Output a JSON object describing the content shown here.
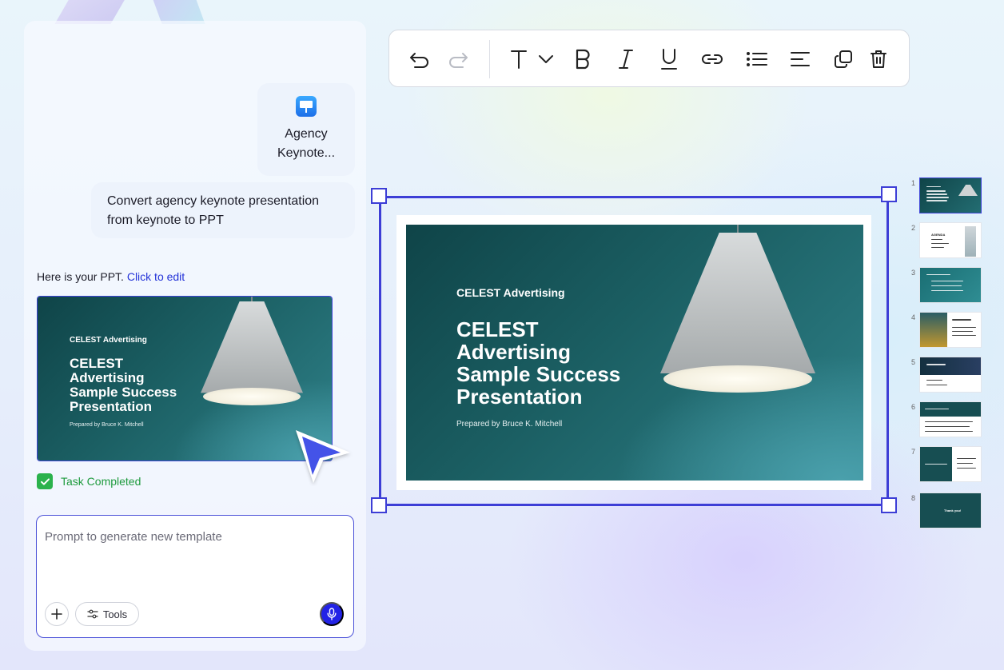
{
  "chat": {
    "attachment": {
      "icon": "keynote-icon",
      "name_line1": "Agency",
      "name_line2": "Keynote..."
    },
    "user_message": "Convert agency keynote presentation from keynote to PPT",
    "assistant_reply": {
      "text": "Here is your PPT. ",
      "link": "Click to edit"
    },
    "task_status": "Task Completed",
    "prompt": {
      "placeholder": "Prompt to generate new template",
      "value": ""
    },
    "tools_label": "Tools"
  },
  "toolbar": {
    "icons": [
      "undo-icon",
      "redo-icon",
      "text-icon",
      "chevron-down-icon",
      "bold-icon",
      "italic-icon",
      "underline-icon",
      "link-icon",
      "list-icon",
      "align-icon",
      "duplicate-icon",
      "trash-icon"
    ]
  },
  "slide": {
    "brand": "CELEST Advertising",
    "title_lines": [
      "CELEST",
      "Advertising",
      "Sample Success",
      "Presentation"
    ],
    "subtitle": "Prepared by Bruce K. Mitchell"
  },
  "slides_rail": [
    {
      "number": "1",
      "label": "CELEST Advertising Sample Success Presentation"
    },
    {
      "number": "2",
      "label": "AGENDA"
    },
    {
      "number": "3",
      "label": "CELEST Advertising Services"
    },
    {
      "number": "4",
      "label": "Product Strategy and Development"
    },
    {
      "number": "5",
      "label": "Email Marketing and Online Sales"
    },
    {
      "number": "6",
      "label": "Social Media Advertising"
    },
    {
      "number": "7",
      "label": "Outcomes/Goals"
    },
    {
      "number": "8",
      "label": "Thank you!"
    }
  ],
  "colors": {
    "accent": "#3d3ed6",
    "success": "#2bb24c",
    "slide_teal": "#1b5f63",
    "mic_button": "#2323e6"
  }
}
